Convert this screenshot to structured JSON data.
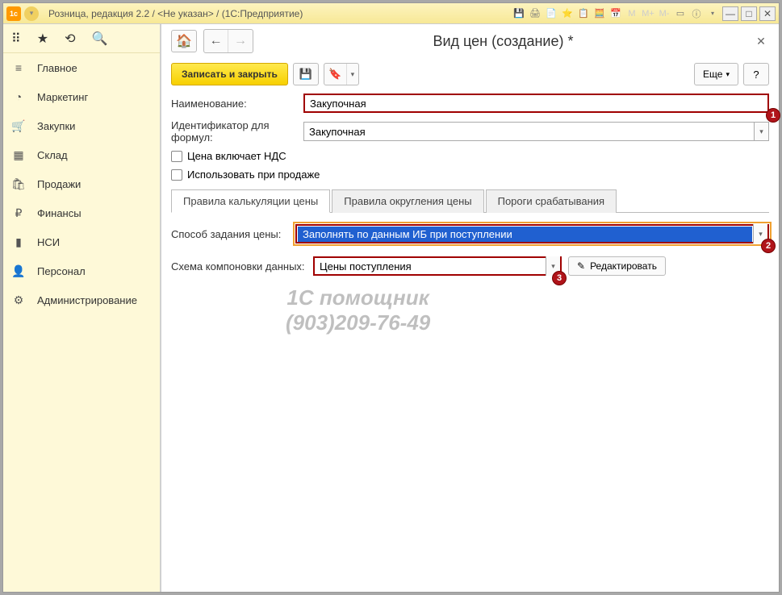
{
  "titlebar": {
    "app_icon": "1c",
    "title": "Розница, редакция 2.2 / <Не указан> / (1С:Предприятие)"
  },
  "sidebar": {
    "items": [
      {
        "icon": "≡",
        "label": "Главное"
      },
      {
        "icon": "◔",
        "label": "Маркетинг"
      },
      {
        "icon": "🛒",
        "label": "Закупки"
      },
      {
        "icon": "▦",
        "label": "Склад"
      },
      {
        "icon": "🛍",
        "label": "Продажи"
      },
      {
        "icon": "₽",
        "label": "Финансы"
      },
      {
        "icon": "▮",
        "label": "НСИ"
      },
      {
        "icon": "👤",
        "label": "Персонал"
      },
      {
        "icon": "⚙",
        "label": "Администрирование"
      }
    ]
  },
  "page": {
    "title": "Вид цен (создание) *"
  },
  "toolbar": {
    "save_close": "Записать и закрыть",
    "more": "Еще",
    "help": "?"
  },
  "form": {
    "name_label": "Наименование:",
    "name_value": "Закупочная",
    "id_label": "Идентификатор для формул:",
    "id_value": "Закупочная",
    "cb1_label": "Цена включает НДС",
    "cb2_label": "Использовать при продаже"
  },
  "tabs": {
    "t1": "Правила калькуляции цены",
    "t2": "Правила округления цены",
    "t3": "Пороги срабатывания"
  },
  "tab1": {
    "method_label": "Способ задания цены:",
    "method_value": "Заполнять по данным ИБ при поступлении",
    "schema_label": "Схема компоновки данных:",
    "schema_value": "Цены поступления",
    "edit_btn": "Редактировать"
  },
  "badges": {
    "b1": "1",
    "b2": "2",
    "b3": "3"
  },
  "watermark": {
    "l1": "1С помощник",
    "l2": "(903)209-76-49"
  }
}
